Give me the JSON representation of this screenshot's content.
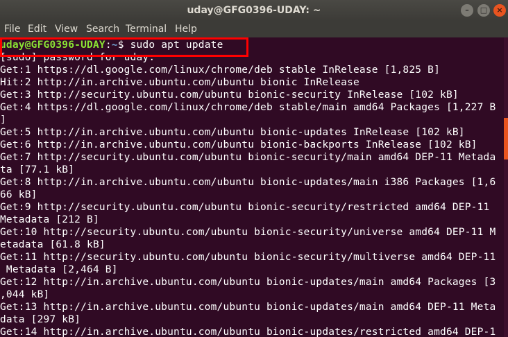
{
  "window": {
    "title": "uday@GFG0396-UDAY: ~",
    "buttons": {
      "minimize_glyph": "–",
      "maximize_glyph": "□",
      "close_glyph": "×"
    }
  },
  "menu": {
    "items": [
      "File",
      "Edit",
      "View",
      "Search",
      "Terminal",
      "Help"
    ]
  },
  "terminal": {
    "prompt": {
      "user_host": "uday@GFG0396-UDAY",
      "path": "~",
      "symbol": "$",
      "command": "sudo apt update"
    },
    "lines": [
      "[sudo] password for uday:",
      "Get:1 https://dl.google.com/linux/chrome/deb stable InRelease [1,825 B]",
      "Hit:2 http://in.archive.ubuntu.com/ubuntu bionic InRelease",
      "Get:3 http://security.ubuntu.com/ubuntu bionic-security InRelease [102 kB]",
      "Get:4 https://dl.google.com/linux/chrome/deb stable/main amd64 Packages [1,227 B",
      "]",
      "Get:5 http://in.archive.ubuntu.com/ubuntu bionic-updates InRelease [102 kB]",
      "Get:6 http://in.archive.ubuntu.com/ubuntu bionic-backports InRelease [102 kB]",
      "Get:7 http://security.ubuntu.com/ubuntu bionic-security/main amd64 DEP-11 Metada",
      "ta [77.1 kB]",
      "Get:8 http://in.archive.ubuntu.com/ubuntu bionic-updates/main i386 Packages [1,6",
      "66 kB]",
      "Get:9 http://security.ubuntu.com/ubuntu bionic-security/restricted amd64 DEP-11",
      "Metadata [212 B]",
      "Get:10 http://security.ubuntu.com/ubuntu bionic-security/universe amd64 DEP-11 M",
      "etadata [61.8 kB]",
      "Get:11 http://security.ubuntu.com/ubuntu bionic-security/multiverse amd64 DEP-11",
      " Metadata [2,464 B]",
      "Get:12 http://in.archive.ubuntu.com/ubuntu bionic-updates/main amd64 Packages [3",
      ",044 kB]",
      "Get:13 http://in.archive.ubuntu.com/ubuntu bionic-updates/main amd64 DEP-11 Meta",
      "data [297 kB]",
      "Get:14 http://in.archive.ubuntu.com/ubuntu bionic-updates/restricted amd64 DEP-1"
    ]
  },
  "colors": {
    "terminal_background": "#300a24",
    "prompt_user": "#8ae234",
    "prompt_path": "#729fcf",
    "highlight_box": "#ff0000",
    "close_button": "#e95420"
  }
}
